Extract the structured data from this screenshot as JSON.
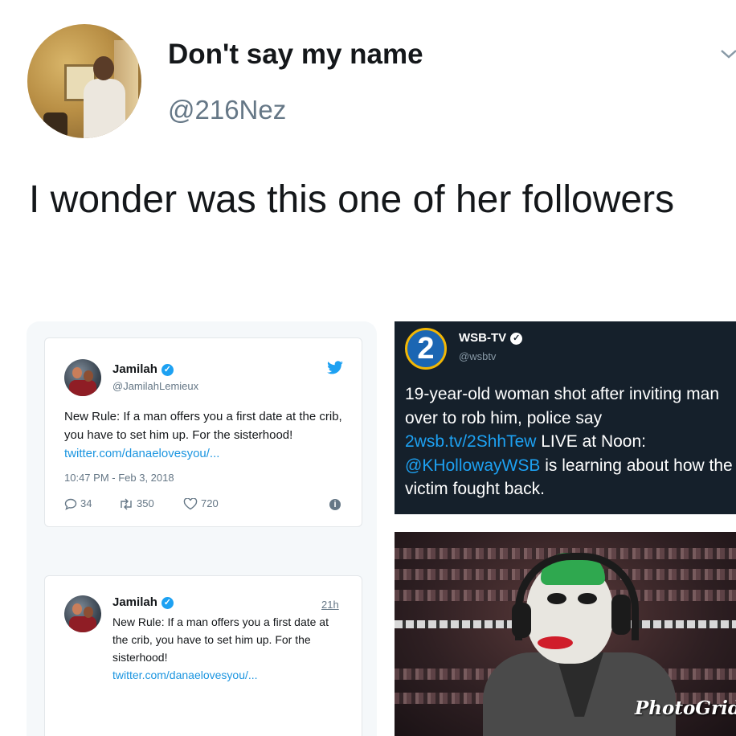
{
  "tweet": {
    "display_name": "Don't say my name",
    "handle": "@216Nez",
    "text": "I wonder was this one of her followers"
  },
  "embedded_tweet_1": {
    "name": "Jamilah",
    "handle": "@JamilahLemieux",
    "body": "New Rule: If a man offers you a first date at the crib, you have to set him up. For the sisterhood!",
    "link": "twitter.com/danaelovesyou/...",
    "timestamp": "10:47 PM - Feb 3, 2018",
    "replies": "34",
    "retweets": "350",
    "likes": "720"
  },
  "embedded_tweet_2": {
    "name": "Jamilah",
    "time": "21h",
    "body": "New Rule: If a man offers you a first date at the crib, you have to set him up. For the sisterhood!",
    "link": "twitter.com/danaelovesyou/..."
  },
  "news_tweet": {
    "logo_text": "2",
    "name": "WSB-TV",
    "handle": "@wsbtv",
    "text_part1": "19-year-old woman shot after inviting man over to rob him, police say ",
    "link1": "2wsb.tv/2ShhTew",
    "text_part2": " LIVE at Noon: ",
    "mention": "@KHollowayWSB",
    "text_part3": " is learning about how the victim fought back."
  },
  "image_watermark": "PhotoGrid",
  "colors": {
    "twitter_blue": "#1da1f2",
    "news_bg": "#15202b",
    "secondary_text": "#657786"
  }
}
